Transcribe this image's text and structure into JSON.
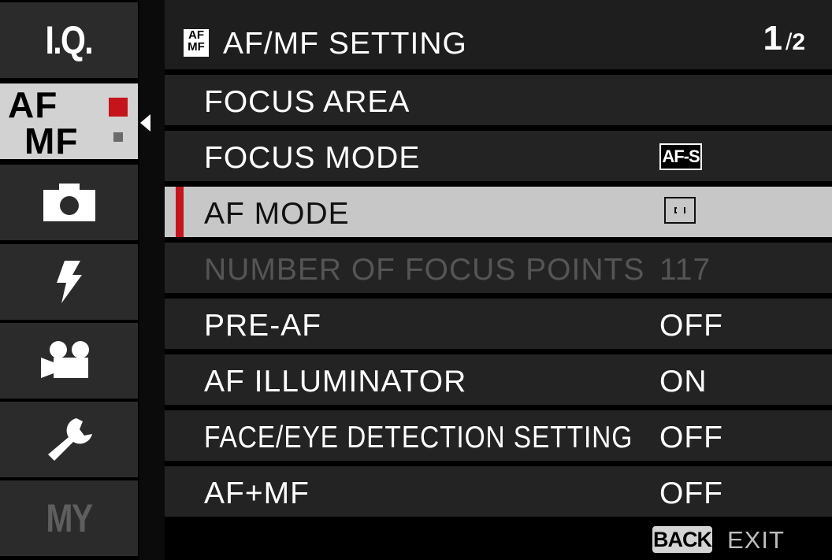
{
  "sidebar": {
    "tabs": [
      {
        "id": "iq",
        "label": "I.Q."
      },
      {
        "id": "afmf",
        "label_top": "AF",
        "label_bottom": "MF",
        "active": true
      },
      {
        "id": "shooting",
        "icon": "camera-icon"
      },
      {
        "id": "flash",
        "icon": "flash-icon"
      },
      {
        "id": "movie",
        "icon": "movie-camera-icon"
      },
      {
        "id": "setup",
        "icon": "wrench-icon"
      },
      {
        "id": "my",
        "label": "MY"
      }
    ]
  },
  "header": {
    "icon_top": "AF",
    "icon_bottom": "MF",
    "title": "AF/MF SETTING",
    "page_current": "1",
    "page_separator": "/",
    "page_total": "2"
  },
  "menu": {
    "items": [
      {
        "label": "FOCUS AREA",
        "value": ""
      },
      {
        "label": "FOCUS MODE",
        "value": "AF-S",
        "value_icon": "af-s-badge-icon"
      },
      {
        "label": "AF MODE",
        "value": "",
        "value_icon": "single-point-af-icon",
        "selected": true
      },
      {
        "label": "NUMBER OF FOCUS POINTS",
        "value": "117",
        "disabled": true
      },
      {
        "label": "PRE-AF",
        "value": "OFF"
      },
      {
        "label": "AF ILLUMINATOR",
        "value": "ON"
      },
      {
        "label": "FACE/EYE DETECTION SETTING",
        "value": "OFF"
      },
      {
        "label": "AF+MF",
        "value": "OFF"
      }
    ]
  },
  "footer": {
    "back_label": "BACK",
    "exit_label": "EXIT"
  },
  "colors": {
    "accent_red": "#c4151c",
    "selected_row": "#c7c7c7",
    "row_bg": "#232323",
    "sidebar_tab": "#2b2b2b"
  }
}
